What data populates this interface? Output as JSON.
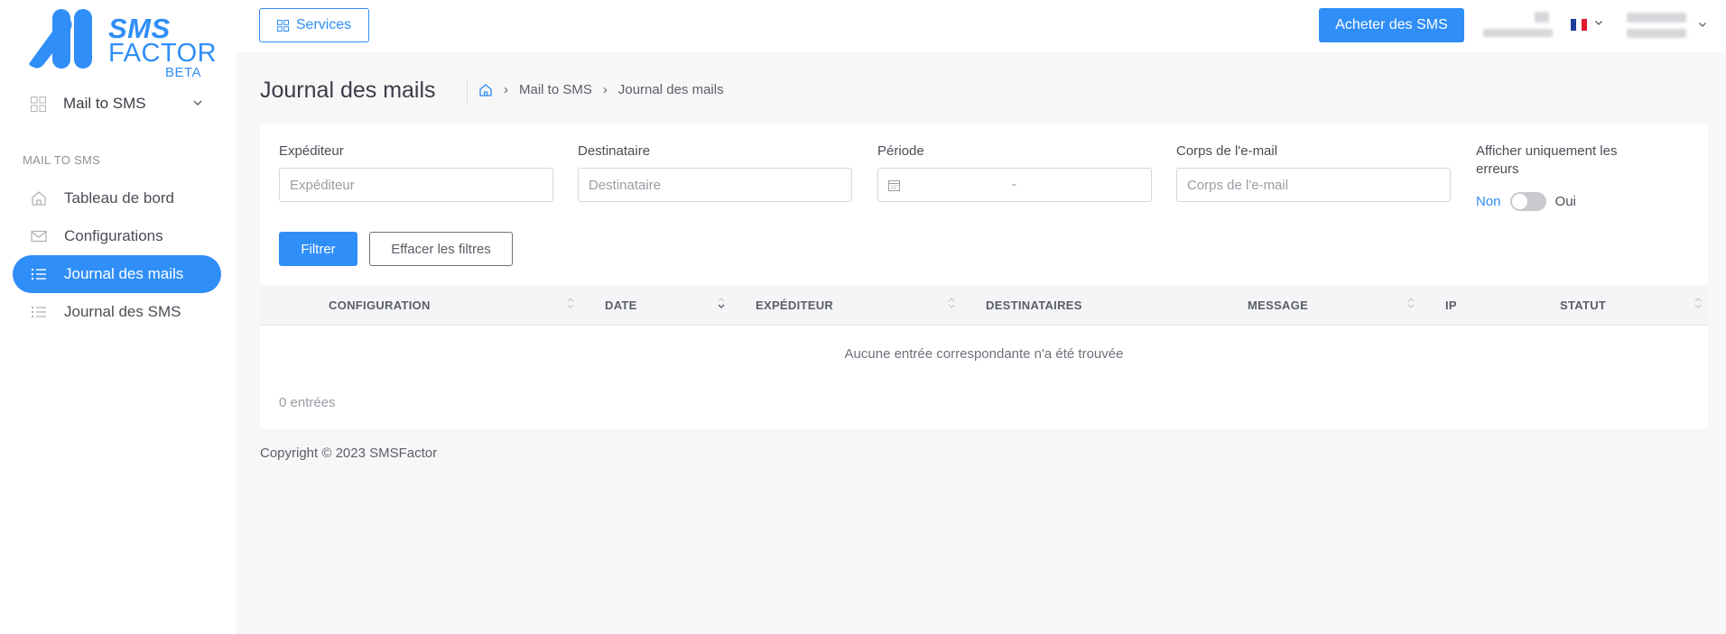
{
  "brand": {
    "line1": "SMS",
    "line2": "FACTOR",
    "badge": "BETA",
    "color": "#2f8ef7"
  },
  "sidebar": {
    "module_dropdown": {
      "label": "Mail to SMS",
      "icon": "grid-icon"
    },
    "section_title": "MAIL TO SMS",
    "items": [
      {
        "label": "Tableau de bord",
        "icon": "home-icon",
        "active": false
      },
      {
        "label": "Configurations",
        "icon": "envelope-icon",
        "active": false
      },
      {
        "label": "Journal des mails",
        "icon": "list-icon",
        "active": true
      },
      {
        "label": "Journal des SMS",
        "icon": "list-icon",
        "active": false
      }
    ]
  },
  "topbar": {
    "services_label": "Services",
    "buy_label": "Acheter des SMS",
    "language": "fr"
  },
  "page": {
    "title": "Journal des mails",
    "breadcrumb": [
      "Mail to SMS",
      "Journal des mails"
    ]
  },
  "filters": {
    "sender": {
      "label": "Expéditeur",
      "placeholder": "Expéditeur",
      "value": ""
    },
    "recipient": {
      "label": "Destinataire",
      "placeholder": "Destinataire",
      "value": ""
    },
    "period": {
      "label": "Période",
      "separator": "-"
    },
    "body": {
      "label": "Corps de l'e-mail",
      "placeholder": "Corps de l'e-mail",
      "value": ""
    },
    "errors_only": {
      "label_line1": "Afficher uniquement les",
      "label_line2": "erreurs",
      "off_label": "Non",
      "on_label": "Oui",
      "enabled": false
    },
    "filter_button": "Filtrer",
    "clear_button": "Effacer les filtres"
  },
  "table": {
    "columns": [
      "CONFIGURATION",
      "DATE",
      "EXPÉDITEUR",
      "DESTINATAIRES",
      "MESSAGE",
      "IP",
      "STATUT"
    ],
    "rows": [],
    "empty_message": "Aucune entrée correspondante n'a été trouvée",
    "entries_count": "0 entrées"
  },
  "footer": {
    "copyright": "Copyright © 2023 SMSFactor"
  }
}
